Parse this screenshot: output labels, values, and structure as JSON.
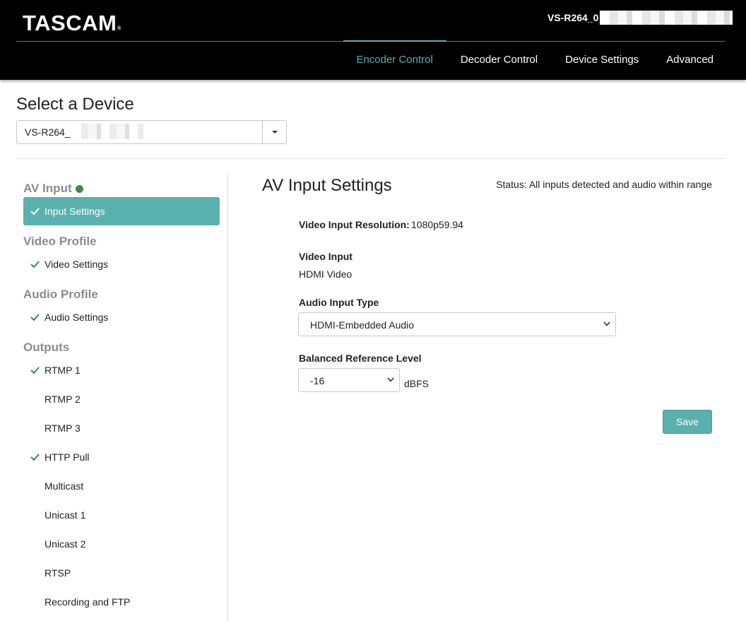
{
  "brand": {
    "logo_text": "TASCAM",
    "logo_mark": "®"
  },
  "header": {
    "device_name_prefix": "VS-R264_0",
    "nav": [
      {
        "label": "Encoder Control",
        "active": true
      },
      {
        "label": "Decoder Control",
        "active": false
      },
      {
        "label": "Device Settings",
        "active": false
      },
      {
        "label": "Advanced",
        "active": false
      }
    ],
    "accent_color": "#5ab0ad"
  },
  "device_picker": {
    "title": "Select a Device",
    "selected_value": "VS-R264_"
  },
  "sidebar": {
    "sections": [
      {
        "heading": "AV Input",
        "status_dot_color": "#3e8b4a"
      },
      {
        "heading": "Video Profile"
      },
      {
        "heading": "Audio Profile"
      },
      {
        "heading": "Outputs"
      }
    ],
    "items": [
      {
        "label": "Input Settings",
        "checked": true,
        "active": true
      },
      {
        "label": "Video Settings",
        "checked": true
      },
      {
        "label": "Audio Settings",
        "checked": true
      },
      {
        "label": "RTMP 1",
        "checked": true
      },
      {
        "label": "RTMP 2",
        "checked": false
      },
      {
        "label": "RTMP 3",
        "checked": false
      },
      {
        "label": "HTTP Pull",
        "checked": true
      },
      {
        "label": "Multicast",
        "checked": false
      },
      {
        "label": "Unicast 1",
        "checked": false
      },
      {
        "label": "Unicast 2",
        "checked": false
      },
      {
        "label": "RTSP",
        "checked": false
      },
      {
        "label": "Recording and FTP",
        "checked": false
      }
    ]
  },
  "main": {
    "title": "AV Input Settings",
    "status": "Status: All inputs detected and audio within range",
    "video_resolution_label": "Video Input Resolution:",
    "video_resolution_value": "1080p59.94",
    "video_input_label": "Video Input",
    "video_input_value": "HDMI Video",
    "audio_input_type_label": "Audio Input Type",
    "audio_input_type_value": "HDMI-Embedded Audio",
    "balanced_ref_label": "Balanced Reference Level",
    "balanced_ref_value": "-16",
    "balanced_ref_unit": "dBFS",
    "save_label": "Save"
  }
}
